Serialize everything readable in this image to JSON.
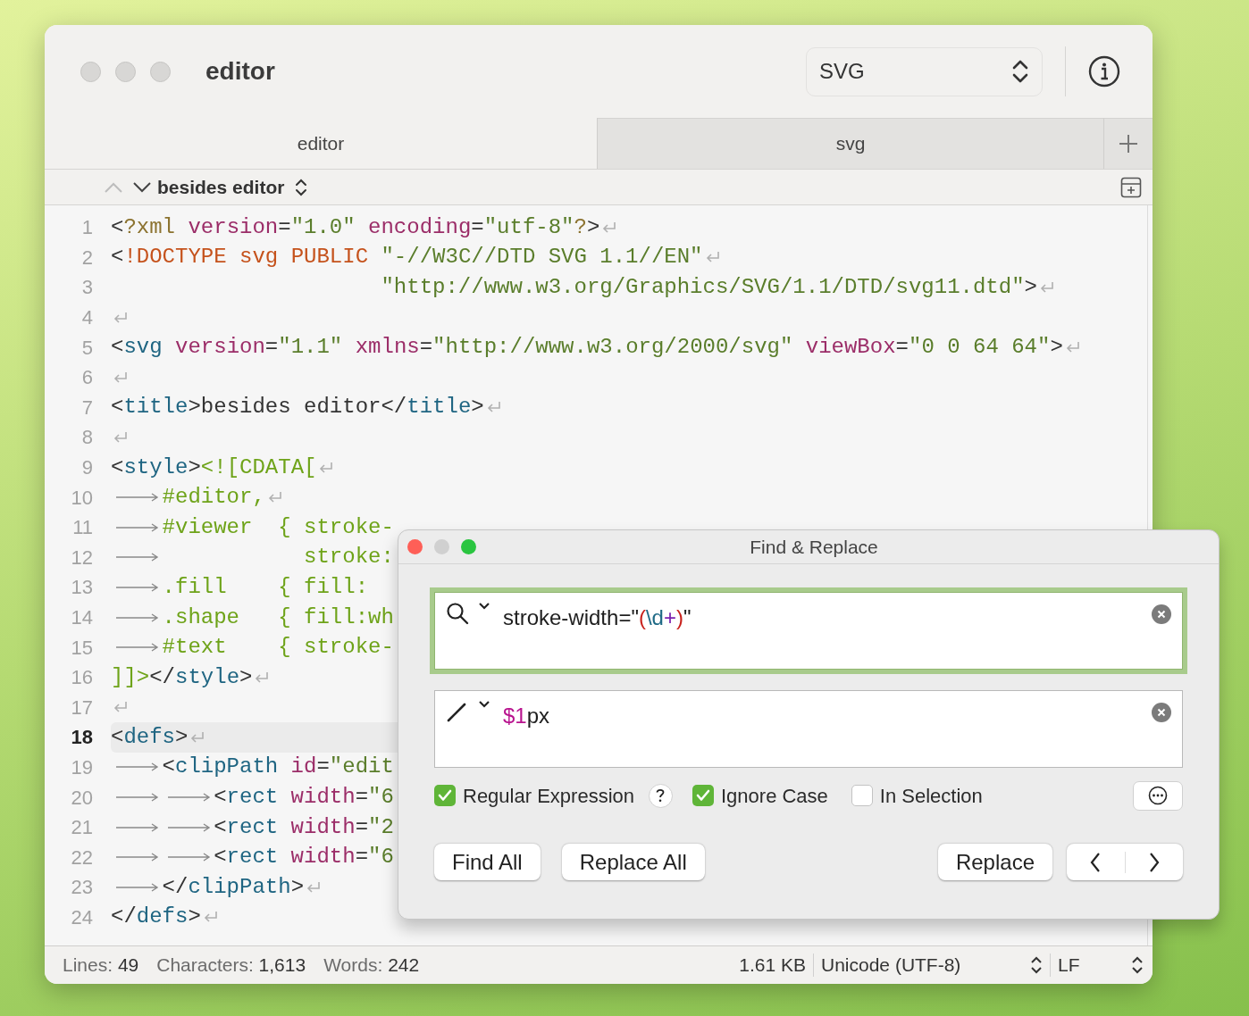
{
  "window": {
    "title": "editor"
  },
  "syntax_popup": {
    "value": "SVG"
  },
  "tabs": [
    {
      "label": "editor",
      "selected": true
    },
    {
      "label": "svg",
      "selected": false
    }
  ],
  "navigator": {
    "title": "besides editor"
  },
  "editor": {
    "lines": [
      {
        "number": "1",
        "current": false,
        "tokens": [
          {
            "kind": "punct",
            "text": "<"
          },
          {
            "kind": "pi",
            "text": "?xml"
          },
          {
            "kind": "attr",
            "text": " version"
          },
          {
            "kind": "punct",
            "text": "="
          },
          {
            "kind": "str",
            "text": "\"1.0\""
          },
          {
            "kind": "attr",
            "text": " encoding"
          },
          {
            "kind": "punct",
            "text": "="
          },
          {
            "kind": "str",
            "text": "\"utf-8\""
          },
          {
            "kind": "pi",
            "text": "?"
          },
          {
            "kind": "punct",
            "text": ">"
          },
          {
            "kind": "eol"
          }
        ]
      },
      {
        "number": "2",
        "current": false,
        "tokens": [
          {
            "kind": "punct",
            "text": "<"
          },
          {
            "kind": "doctype",
            "text": "!DOCTYPE svg PUBLIC"
          },
          {
            "kind": "str",
            "text": " \"-//W3C//DTD SVG 1.1//EN\""
          },
          {
            "kind": "eol"
          }
        ]
      },
      {
        "number": "3",
        "current": false,
        "tokens": [
          {
            "kind": "str",
            "text": "                     \"http://www.w3.org/Graphics/SVG/1.1/DTD/svg11.dtd\""
          },
          {
            "kind": "punct",
            "text": ">"
          },
          {
            "kind": "eol"
          }
        ]
      },
      {
        "number": "4",
        "current": false,
        "tokens": [
          {
            "kind": "eol"
          }
        ]
      },
      {
        "number": "5",
        "current": false,
        "tokens": [
          {
            "kind": "punct",
            "text": "<"
          },
          {
            "kind": "tag",
            "text": "svg"
          },
          {
            "kind": "attr",
            "text": " version"
          },
          {
            "kind": "punct",
            "text": "="
          },
          {
            "kind": "str",
            "text": "\"1.1\""
          },
          {
            "kind": "attr",
            "text": " xmlns"
          },
          {
            "kind": "punct",
            "text": "="
          },
          {
            "kind": "str",
            "text": "\"http://www.w3.org/2000/svg\""
          },
          {
            "kind": "attr",
            "text": " viewBox"
          },
          {
            "kind": "punct",
            "text": "="
          },
          {
            "kind": "str",
            "text": "\"0 0 64 64\""
          },
          {
            "kind": "punct",
            "text": ">"
          },
          {
            "kind": "eol"
          }
        ]
      },
      {
        "number": "6",
        "current": false,
        "tokens": [
          {
            "kind": "eol"
          }
        ]
      },
      {
        "number": "7",
        "current": false,
        "tokens": [
          {
            "kind": "punct",
            "text": "<"
          },
          {
            "kind": "tag",
            "text": "title"
          },
          {
            "kind": "punct",
            "text": ">besides editor</"
          },
          {
            "kind": "tag",
            "text": "title"
          },
          {
            "kind": "punct",
            "text": ">"
          },
          {
            "kind": "eol"
          }
        ]
      },
      {
        "number": "8",
        "current": false,
        "tokens": [
          {
            "kind": "eol"
          }
        ]
      },
      {
        "number": "9",
        "current": false,
        "tokens": [
          {
            "kind": "punct",
            "text": "<"
          },
          {
            "kind": "tag",
            "text": "style"
          },
          {
            "kind": "punct",
            "text": ">"
          },
          {
            "kind": "css",
            "text": "<![CDATA["
          },
          {
            "kind": "eol"
          }
        ]
      },
      {
        "number": "10",
        "current": false,
        "tokens": [
          {
            "kind": "tab"
          },
          {
            "kind": "css",
            "text": "#editor,"
          },
          {
            "kind": "eol"
          }
        ]
      },
      {
        "number": "11",
        "current": false,
        "tokens": [
          {
            "kind": "tab"
          },
          {
            "kind": "css",
            "text": "#viewer  { stroke-"
          }
        ]
      },
      {
        "number": "12",
        "current": false,
        "tokens": [
          {
            "kind": "tab"
          },
          {
            "kind": "css",
            "text": "           stroke:"
          }
        ]
      },
      {
        "number": "13",
        "current": false,
        "tokens": [
          {
            "kind": "tab"
          },
          {
            "kind": "css",
            "text": ".fill    { fill:"
          }
        ]
      },
      {
        "number": "14",
        "current": false,
        "tokens": [
          {
            "kind": "tab"
          },
          {
            "kind": "css",
            "text": ".shape   { fill:wh"
          }
        ]
      },
      {
        "number": "15",
        "current": false,
        "tokens": [
          {
            "kind": "tab"
          },
          {
            "kind": "css",
            "text": "#text    { stroke-"
          }
        ]
      },
      {
        "number": "16",
        "current": false,
        "tokens": [
          {
            "kind": "css",
            "text": "]]>"
          },
          {
            "kind": "punct",
            "text": "</"
          },
          {
            "kind": "tag",
            "text": "style"
          },
          {
            "kind": "punct",
            "text": ">"
          },
          {
            "kind": "eol"
          }
        ]
      },
      {
        "number": "17",
        "current": false,
        "tokens": [
          {
            "kind": "eol"
          }
        ]
      },
      {
        "number": "18",
        "current": true,
        "tokens": [
          {
            "kind": "punct",
            "text": "<"
          },
          {
            "kind": "tag",
            "text": "defs"
          },
          {
            "kind": "punct",
            "text": ">"
          },
          {
            "kind": "eol"
          }
        ]
      },
      {
        "number": "19",
        "current": false,
        "tokens": [
          {
            "kind": "tab"
          },
          {
            "kind": "punct",
            "text": "<"
          },
          {
            "kind": "tag",
            "text": "clipPath"
          },
          {
            "kind": "attr",
            "text": " id"
          },
          {
            "kind": "punct",
            "text": "="
          },
          {
            "kind": "str",
            "text": "\"edit"
          }
        ]
      },
      {
        "number": "20",
        "current": false,
        "tokens": [
          {
            "kind": "tab"
          },
          {
            "kind": "tab"
          },
          {
            "kind": "punct",
            "text": "<"
          },
          {
            "kind": "tag",
            "text": "rect"
          },
          {
            "kind": "attr",
            "text": " width"
          },
          {
            "kind": "punct",
            "text": "="
          },
          {
            "kind": "str",
            "text": "\"6"
          }
        ]
      },
      {
        "number": "21",
        "current": false,
        "tokens": [
          {
            "kind": "tab"
          },
          {
            "kind": "tab"
          },
          {
            "kind": "punct",
            "text": "<"
          },
          {
            "kind": "tag",
            "text": "rect"
          },
          {
            "kind": "attr",
            "text": " width"
          },
          {
            "kind": "punct",
            "text": "="
          },
          {
            "kind": "str",
            "text": "\"2"
          }
        ]
      },
      {
        "number": "22",
        "current": false,
        "tokens": [
          {
            "kind": "tab"
          },
          {
            "kind": "tab"
          },
          {
            "kind": "punct",
            "text": "<"
          },
          {
            "kind": "tag",
            "text": "rect"
          },
          {
            "kind": "attr",
            "text": " width"
          },
          {
            "kind": "punct",
            "text": "="
          },
          {
            "kind": "str",
            "text": "\"6"
          }
        ]
      },
      {
        "number": "23",
        "current": false,
        "tokens": [
          {
            "kind": "tab"
          },
          {
            "kind": "punct",
            "text": "</"
          },
          {
            "kind": "tag",
            "text": "clipPath"
          },
          {
            "kind": "punct",
            "text": ">"
          },
          {
            "kind": "eol"
          }
        ]
      },
      {
        "number": "24",
        "current": false,
        "tokens": [
          {
            "kind": "punct",
            "text": "</"
          },
          {
            "kind": "tag",
            "text": "defs"
          },
          {
            "kind": "punct",
            "text": ">"
          },
          {
            "kind": "eol"
          }
        ]
      }
    ]
  },
  "status_bar": {
    "items": [
      {
        "label": "Lines:",
        "value": "49"
      },
      {
        "label": "Characters:",
        "value": "1,613"
      },
      {
        "label": "Words:",
        "value": "242"
      }
    ],
    "file_size": "1.61 KB",
    "encoding": "Unicode (UTF-8)",
    "line_ending": "LF"
  },
  "find_dialog": {
    "title": "Find & Replace",
    "find": {
      "focused": true,
      "tokens": [
        {
          "kind": "plain",
          "text": "stroke-width=\""
        },
        {
          "kind": "group",
          "text": "("
        },
        {
          "kind": "escape",
          "text": "\\d"
        },
        {
          "kind": "quantifier",
          "text": "+"
        },
        {
          "kind": "group",
          "text": ")"
        },
        {
          "kind": "plain",
          "text": "\""
        }
      ]
    },
    "replace": {
      "focused": false,
      "tokens": [
        {
          "kind": "backref",
          "text": "$1"
        },
        {
          "kind": "plain",
          "text": "px"
        }
      ]
    },
    "options": [
      {
        "label": "Regular Expression",
        "checked": true,
        "help": true
      },
      {
        "label": "Ignore Case",
        "checked": true,
        "help": false
      },
      {
        "label": "In Selection",
        "checked": false,
        "help": false
      }
    ],
    "buttons": [
      "Find All",
      "Replace All",
      "Replace"
    ]
  }
}
